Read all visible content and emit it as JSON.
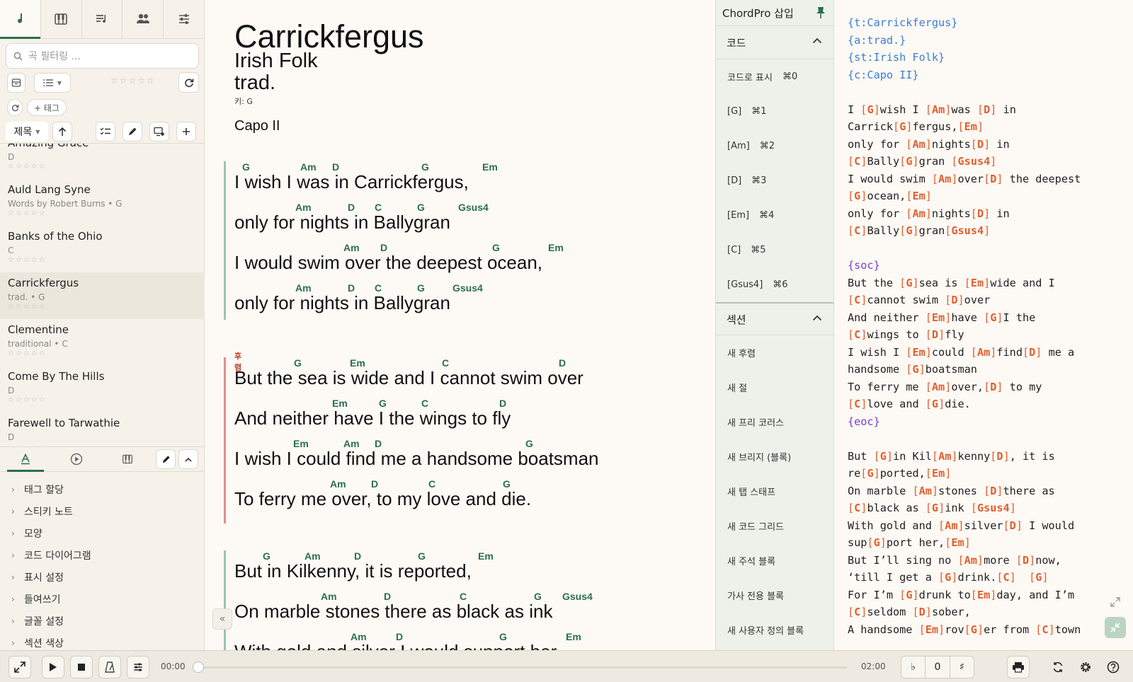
{
  "sidebar": {
    "search_placeholder": "곡 필터링 ...",
    "tag_button": "+ 태그",
    "sort_label": "제목",
    "songs": [
      {
        "title": "Amazing Grace",
        "meta": "D",
        "stars": "☆☆☆☆☆"
      },
      {
        "title": "Auld Lang Syne",
        "meta": "Words by Robert Burns • G",
        "stars": "☆☆☆☆☆"
      },
      {
        "title": "Banks of the Ohio",
        "meta": "C",
        "stars": "☆☆☆☆☆"
      },
      {
        "title": "Carrickfergus",
        "meta": "trad. • G",
        "stars": "☆☆☆☆☆"
      },
      {
        "title": "Clementine",
        "meta": "traditional • C",
        "stars": "☆☆☆☆☆"
      },
      {
        "title": "Come By The Hills",
        "meta": "D",
        "stars": "☆☆☆☆☆"
      },
      {
        "title": "Farewell to Tarwathie",
        "meta": "D",
        "stars": "☆☆☆☆☆"
      }
    ],
    "stars_filter": "☆☆☆☆☆",
    "properties": [
      "태그 할당",
      "스티키 노트",
      "모양",
      "코드 다이어그램",
      "표시 설정",
      "들여쓰기",
      "글꼴 설정",
      "섹션 색상"
    ]
  },
  "song": {
    "title": "Carrickfergus",
    "subtitle": "Irish Folk",
    "artist": "trad.",
    "key": "키: G",
    "capo": "Capo II",
    "chorus_label": "후렴",
    "verse1": [
      {
        "lyric": "I wish I was  in Carrickfergus,",
        "chords": [
          "G",
          "Am",
          "D",
          "G",
          "Em"
        ]
      },
      {
        "lyric": "only for nights in Ballygran",
        "chords": [
          "Am",
          "D",
          "C",
          "G",
          "Gsus4"
        ]
      },
      {
        "lyric": "I would swim over the deepest ocean,",
        "chords": [
          "Am",
          "D",
          "G",
          "Em"
        ]
      },
      {
        "lyric": "only for nights in Ballygran",
        "chords": [
          "Am",
          "D",
          "C",
          "G",
          "Gsus4"
        ]
      }
    ],
    "chorus": [
      {
        "lyric": "But the sea is wide and I cannot swim over",
        "chords": [
          "G",
          "Em",
          "C",
          "D"
        ]
      },
      {
        "lyric": "And neither have I the wings to fly",
        "chords": [
          "Em",
          "G",
          "C",
          "D"
        ]
      },
      {
        "lyric": "I wish I could find me a handsome boatsman",
        "chords": [
          "Em",
          "Am",
          "D",
          "G"
        ]
      },
      {
        "lyric": "To ferry me over, to my love and die.",
        "chords": [
          "Am",
          "D",
          "C",
          "G"
        ]
      }
    ],
    "verse2": [
      {
        "lyric": "But in Kilkenny, it is reported,",
        "chords": [
          "G",
          "Am",
          "D",
          "G",
          "Em"
        ]
      },
      {
        "lyric": "On marble stones there as black as ink",
        "chords": [
          "Am",
          "D",
          "C",
          "G",
          "Gsus4"
        ]
      },
      {
        "lyric": "With gold and silver I would support her,",
        "chords": [
          "Am",
          "D",
          "G",
          "Em"
        ]
      }
    ]
  },
  "insert_panel": {
    "title": "ChordPro 삽입",
    "chords_section": "코드",
    "chord_items": [
      {
        "label": "코드로 표시",
        "shortcut": "⌘0"
      },
      {
        "label": "[G]",
        "shortcut": "⌘1"
      },
      {
        "label": "[Am]",
        "shortcut": "⌘2"
      },
      {
        "label": "[D]",
        "shortcut": "⌘3"
      },
      {
        "label": "[Em]",
        "shortcut": "⌘4"
      },
      {
        "label": "[C]",
        "shortcut": "⌘5"
      },
      {
        "label": "[Gsus4]",
        "shortcut": "⌘6"
      }
    ],
    "sections_section": "섹션",
    "section_items": [
      "새 후렴",
      "새 절",
      "새 프리 코러스",
      "새 브리지 (블록)",
      "새 탭 스태프",
      "새 코드 그리드",
      "새 주석 블록",
      "가사 전용 블록",
      "새 사용자 정의 블록"
    ]
  },
  "editor": {
    "lines": [
      {
        "text": "{t:Carrickfergus}",
        "kind": "dir"
      },
      {
        "text": "{a:trad.}",
        "kind": "dir"
      },
      {
        "text": "{st:Irish Folk}",
        "kind": "dir"
      },
      {
        "text": "{c:Capo II}",
        "kind": "dir"
      },
      {
        "text": "",
        "kind": "plain"
      },
      {
        "text": "I [G]wish I [Am]was [D] in",
        "kind": "chord"
      },
      {
        "text": "Carrick[G]fergus,[Em]",
        "kind": "chord"
      },
      {
        "text": "only for [Am]nights[D] in",
        "kind": "chord"
      },
      {
        "text": "[C]Bally[G]gran [Gsus4]",
        "kind": "chord"
      },
      {
        "text": "I would swim [Am]over[D] the deepest",
        "kind": "chord"
      },
      {
        "text": "[G]ocean,[Em]",
        "kind": "chord"
      },
      {
        "text": "only for [Am]nights[D] in",
        "kind": "chord"
      },
      {
        "text": "[C]Bally[G]gran[Gsus4]",
        "kind": "chord"
      },
      {
        "text": "",
        "kind": "plain"
      },
      {
        "text": "{soc}",
        "kind": "soc"
      },
      {
        "text": "But the [G]sea is [Em]wide and I",
        "kind": "chord"
      },
      {
        "text": "[C]cannot swim [D]over",
        "kind": "chord"
      },
      {
        "text": "And neither [Em]have [G]I the",
        "kind": "chord"
      },
      {
        "text": "[C]wings to [D]fly",
        "kind": "chord"
      },
      {
        "text": "I wish I [Em]could [Am]find[D] me a",
        "kind": "chord"
      },
      {
        "text": "handsome [G]boatsman",
        "kind": "chord"
      },
      {
        "text": "To ferry me [Am]over,[D] to my",
        "kind": "chord"
      },
      {
        "text": "[C]love and [G]die.",
        "kind": "chord"
      },
      {
        "text": "{eoc}",
        "kind": "soc"
      },
      {
        "text": "",
        "kind": "plain"
      },
      {
        "text": "But [G]in Kil[Am]kenny[D], it is",
        "kind": "chord"
      },
      {
        "text": "re[G]ported,[Em]",
        "kind": "chord"
      },
      {
        "text": "On marble [Am]stones [D]there as",
        "kind": "chord"
      },
      {
        "text": "[C]black as [G]ink [Gsus4]",
        "kind": "chord"
      },
      {
        "text": "With gold and [Am]silver[D] I would",
        "kind": "chord"
      },
      {
        "text": "sup[G]port her,[Em]",
        "kind": "chord"
      },
      {
        "text": "But I’ll sing no [Am]more [D]now,",
        "kind": "chord"
      },
      {
        "text": "‘till I get a [G]drink.[C]  [G]",
        "kind": "chord"
      },
      {
        "text": "For I’m [G]drunk to[Em]day, and I’m",
        "kind": "chord"
      },
      {
        "text": "[C]seldom [D]sober,",
        "kind": "chord"
      },
      {
        "text": "A handsome [Em]rov[G]er from [C]town",
        "kind": "chord"
      }
    ]
  },
  "player": {
    "time_elapsed": "00:00",
    "time_total": "02:00",
    "progress": 0,
    "transpose_flat": "♭",
    "transpose_value": "0",
    "transpose_sharp": "♯"
  },
  "colors": {
    "accent": "#2c6e4f",
    "chord": "#2c6e4f",
    "chorus_bar": "#e08e8e",
    "verse_bar": "#9bc2ad",
    "editor_chord": "#e06030",
    "editor_directive": "#3b7dd8"
  }
}
